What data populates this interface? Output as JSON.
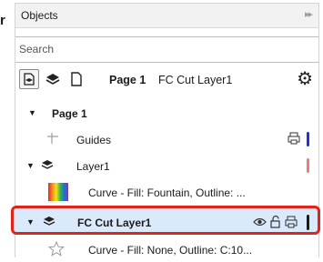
{
  "edge_char": "r",
  "panel": {
    "title": "Objects",
    "collapse_glyph": "▸▸"
  },
  "search": {
    "placeholder": "Search",
    "value": ""
  },
  "toolbar": {
    "page_label": "Page 1",
    "layer_label": "FC Cut Layer1"
  },
  "tree": {
    "page": {
      "label": "Page 1"
    },
    "guides": {
      "label": "Guides",
      "color": "#1f2ee8"
    },
    "layer1": {
      "label": "Layer1",
      "color": "#f07a7a"
    },
    "curve_fountain": {
      "label": "Curve - Fill: Fountain, Outline: ..."
    },
    "fc_cut_layer": {
      "label": "FC Cut Layer1",
      "color": "#1b1b1b"
    },
    "curve_none": {
      "label": "Curve - Fill: None, Outline: C:10..."
    }
  },
  "colors": {
    "selection_bg": "#dbeafb",
    "selection_border": "#e2231a"
  }
}
